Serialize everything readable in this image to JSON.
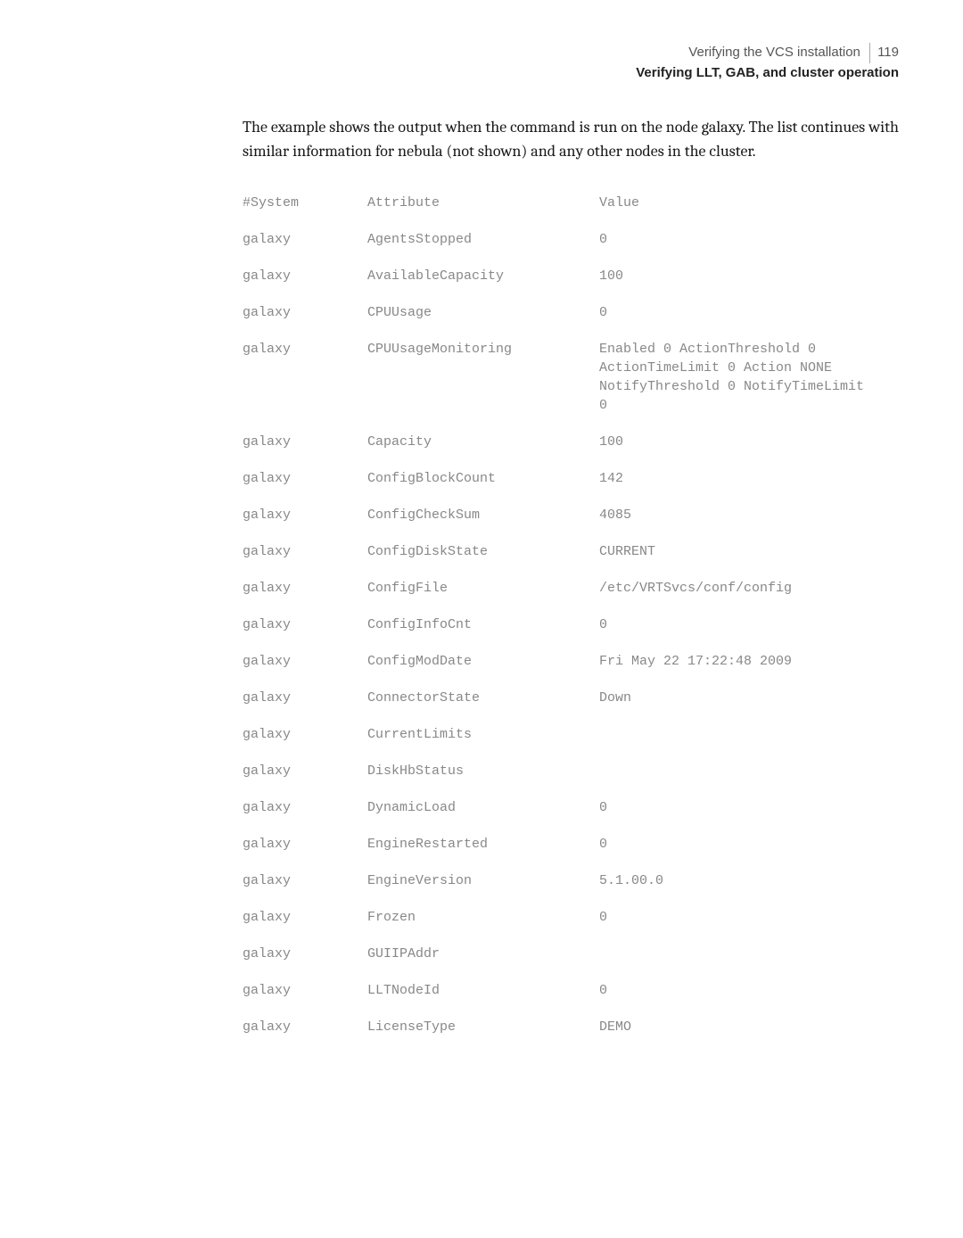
{
  "header": {
    "line1": "Verifying the VCS installation",
    "pagenum": "119",
    "line2": "Verifying LLT, GAB, and cluster operation"
  },
  "intro": "The example shows the output when the command is run on the node galaxy. The list continues with similar information for nebula (not shown) and any other nodes in the cluster.",
  "table": {
    "header": {
      "system": "#System",
      "attribute": "Attribute",
      "value": "Value"
    },
    "rows": [
      {
        "system": "galaxy",
        "attribute": "AgentsStopped",
        "value": "0"
      },
      {
        "system": "galaxy",
        "attribute": "AvailableCapacity",
        "value": "100"
      },
      {
        "system": "galaxy",
        "attribute": "CPUUsage",
        "value": "0"
      },
      {
        "system": "galaxy",
        "attribute": "CPUUsageMonitoring",
        "value": "Enabled 0 ActionThreshold 0 ActionTimeLimit 0 Action NONE NotifyThreshold 0 NotifyTimeLimit 0"
      },
      {
        "system": "galaxy",
        "attribute": "Capacity",
        "value": "100"
      },
      {
        "system": "galaxy",
        "attribute": "ConfigBlockCount",
        "value": "142"
      },
      {
        "system": "galaxy",
        "attribute": "ConfigCheckSum",
        "value": "4085"
      },
      {
        "system": "galaxy",
        "attribute": "ConfigDiskState",
        "value": "CURRENT"
      },
      {
        "system": "galaxy",
        "attribute": "ConfigFile",
        "value": "/etc/VRTSvcs/conf/config"
      },
      {
        "system": "galaxy",
        "attribute": "ConfigInfoCnt",
        "value": "0"
      },
      {
        "system": "galaxy",
        "attribute": "ConfigModDate",
        "value": "Fri May 22 17:22:48 2009"
      },
      {
        "system": "galaxy",
        "attribute": "ConnectorState",
        "value": "Down"
      },
      {
        "system": "galaxy",
        "attribute": "CurrentLimits",
        "value": ""
      },
      {
        "system": "galaxy",
        "attribute": "DiskHbStatus",
        "value": ""
      },
      {
        "system": "galaxy",
        "attribute": "DynamicLoad",
        "value": "0"
      },
      {
        "system": "galaxy",
        "attribute": "EngineRestarted",
        "value": "0"
      },
      {
        "system": "galaxy",
        "attribute": "EngineVersion",
        "value": "5.1.00.0"
      },
      {
        "system": "galaxy",
        "attribute": "Frozen",
        "value": "0"
      },
      {
        "system": "galaxy",
        "attribute": "GUIIPAddr",
        "value": ""
      },
      {
        "system": "galaxy",
        "attribute": "LLTNodeId",
        "value": "0"
      },
      {
        "system": "galaxy",
        "attribute": "LicenseType",
        "value": "DEMO"
      }
    ]
  }
}
